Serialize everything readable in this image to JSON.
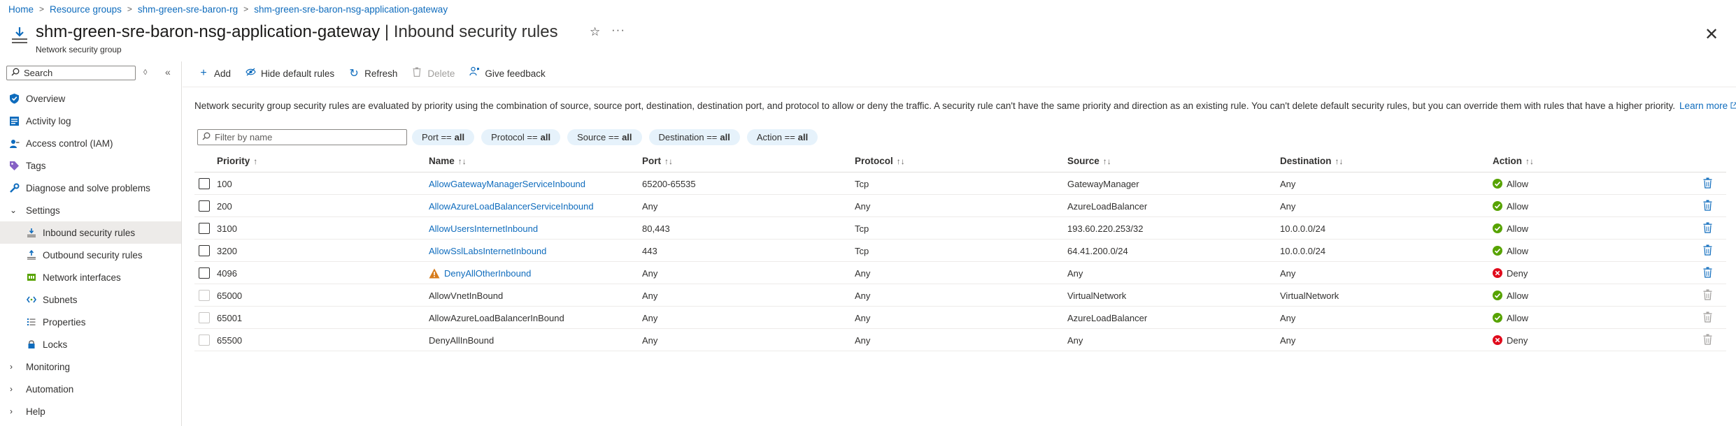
{
  "breadcrumb": {
    "home": "Home",
    "resource_groups": "Resource groups",
    "rg": "shm-green-sre-baron-rg",
    "resource": "shm-green-sre-baron-nsg-application-gateway"
  },
  "header": {
    "resource_name": "shm-green-sre-baron-nsg-application-gateway",
    "separator": " | ",
    "page": "Inbound security rules",
    "subtitle": "Network security group"
  },
  "sidebar": {
    "search_placeholder": "Search",
    "search_count": "◊",
    "items": [
      {
        "label": "Overview",
        "icon": "shield-icon"
      },
      {
        "label": "Activity log",
        "icon": "activity-log-icon"
      },
      {
        "label": "Access control (IAM)",
        "icon": "iam-icon"
      },
      {
        "label": "Tags",
        "icon": "tag-icon"
      },
      {
        "label": "Diagnose and solve problems",
        "icon": "wrench-icon"
      },
      {
        "label": "Settings",
        "icon": "chevron-down-icon"
      },
      {
        "label": "Inbound security rules",
        "icon": "inbound-rules-icon"
      },
      {
        "label": "Outbound security rules",
        "icon": "outbound-rules-icon"
      },
      {
        "label": "Network interfaces",
        "icon": "network-interface-icon"
      },
      {
        "label": "Subnets",
        "icon": "subnet-icon"
      },
      {
        "label": "Properties",
        "icon": "properties-icon"
      },
      {
        "label": "Locks",
        "icon": "lock-icon"
      },
      {
        "label": "Monitoring",
        "icon": "chevron-right-icon"
      },
      {
        "label": "Automation",
        "icon": "chevron-right-icon"
      },
      {
        "label": "Help",
        "icon": "chevron-right-icon"
      }
    ]
  },
  "toolbar": {
    "add": "Add",
    "hide_default": "Hide default rules",
    "refresh": "Refresh",
    "delete": "Delete",
    "feedback": "Give feedback"
  },
  "description": {
    "text": "Network security group security rules are evaluated by priority using the combination of source, source port, destination, destination port, and protocol to allow or deny the traffic. A security rule can't have the same priority and direction as an existing rule. You can't delete default security rules, but you can override them with rules that have a higher priority.",
    "link": "Learn more"
  },
  "filters": {
    "placeholder": "Filter by name",
    "pills": [
      {
        "key": "Port ==",
        "value": "all"
      },
      {
        "key": "Protocol ==",
        "value": "all"
      },
      {
        "key": "Source ==",
        "value": "all"
      },
      {
        "key": "Destination ==",
        "value": "all"
      },
      {
        "key": "Action ==",
        "value": "all"
      }
    ]
  },
  "table": {
    "columns": [
      "Priority",
      "Name",
      "Port",
      "Protocol",
      "Source",
      "Destination",
      "Action"
    ],
    "rows": [
      {
        "priority": "100",
        "name": "AllowGatewayManagerServiceInbound",
        "port": "65200-65535",
        "protocol": "Tcp",
        "source": "GatewayManager",
        "destination": "Any",
        "action": "Allow",
        "default": false,
        "warning": false
      },
      {
        "priority": "200",
        "name": "AllowAzureLoadBalancerServiceInbound",
        "port": "Any",
        "protocol": "Any",
        "source": "AzureLoadBalancer",
        "destination": "Any",
        "action": "Allow",
        "default": false,
        "warning": false
      },
      {
        "priority": "3100",
        "name": "AllowUsersInternetInbound",
        "port": "80,443",
        "protocol": "Tcp",
        "source": "193.60.220.253/32",
        "destination": "10.0.0.0/24",
        "action": "Allow",
        "default": false,
        "warning": false
      },
      {
        "priority": "3200",
        "name": "AllowSslLabsInternetInbound",
        "port": "443",
        "protocol": "Tcp",
        "source": "64.41.200.0/24",
        "destination": "10.0.0.0/24",
        "action": "Allow",
        "default": false,
        "warning": false
      },
      {
        "priority": "4096",
        "name": "DenyAllOtherInbound",
        "port": "Any",
        "protocol": "Any",
        "source": "Any",
        "destination": "Any",
        "action": "Deny",
        "default": false,
        "warning": true
      },
      {
        "priority": "65000",
        "name": "AllowVnetInBound",
        "port": "Any",
        "protocol": "Any",
        "source": "VirtualNetwork",
        "destination": "VirtualNetwork",
        "action": "Allow",
        "default": true,
        "warning": false
      },
      {
        "priority": "65001",
        "name": "AllowAzureLoadBalancerInBound",
        "port": "Any",
        "protocol": "Any",
        "source": "AzureLoadBalancer",
        "destination": "Any",
        "action": "Allow",
        "default": true,
        "warning": false
      },
      {
        "priority": "65500",
        "name": "DenyAllInBound",
        "port": "Any",
        "protocol": "Any",
        "source": "Any",
        "destination": "Any",
        "action": "Deny",
        "default": true,
        "warning": false
      }
    ]
  },
  "colors": {
    "link": "#0f6cbd",
    "allow": "#57a300",
    "deny": "#e00b1c",
    "pill_bg": "#e6f2fb"
  }
}
